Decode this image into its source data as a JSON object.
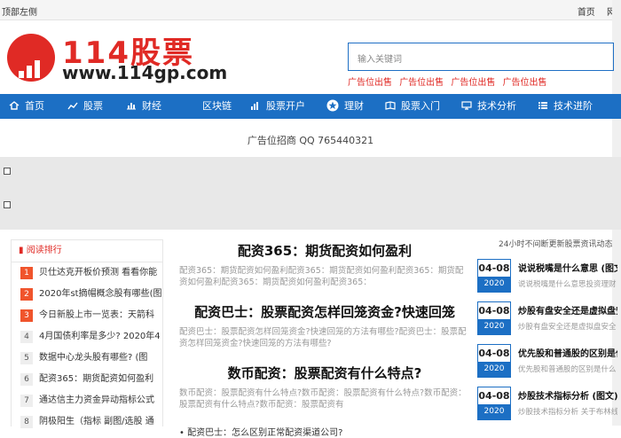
{
  "topbar": {
    "left_text": "顶部左侧",
    "links": [
      "首页",
      "网"
    ]
  },
  "logo": {
    "title": "114股票",
    "url": "www.114gp.com"
  },
  "search": {
    "placeholder": "输入关键词"
  },
  "header_ads": [
    "广告位出售",
    "广告位出售",
    "广告位出售",
    "广告位出售"
  ],
  "nav": [
    {
      "label": "首页",
      "icon": "home-icon"
    },
    {
      "label": "股票",
      "icon": "chart-line-icon"
    },
    {
      "label": "财经",
      "icon": "bar-chart-icon"
    },
    {
      "label": "区块链",
      "icon": "none"
    },
    {
      "label": "股票开户",
      "icon": "bar-chart-icon"
    },
    {
      "label": "理财",
      "icon": "star-icon"
    },
    {
      "label": "股票入门",
      "icon": "book-icon"
    },
    {
      "label": "技术分析",
      "icon": "monitor-icon"
    },
    {
      "label": "技术进阶",
      "icon": "list-icon"
    }
  ],
  "banner_ad": "广告位招商 QQ 765440321",
  "ranking": {
    "title": "阅读排行",
    "items": [
      {
        "num": "1",
        "text": "贝仕达克开板价预测 看看你能"
      },
      {
        "num": "2",
        "text": "2020年st摘帽概念股有哪些(图"
      },
      {
        "num": "3",
        "text": "今日新股上市一览表：天箭科"
      },
      {
        "num": "4",
        "text": "4月国债利率是多少? 2020年4"
      },
      {
        "num": "5",
        "text": "数据中心龙头股有哪些? (图"
      },
      {
        "num": "6",
        "text": "配资365：期货配资如何盈利"
      },
      {
        "num": "7",
        "text": "通达信主力资金异动指标公式"
      },
      {
        "num": "8",
        "text": "阴极阳生（指标 副图/选股 通"
      }
    ]
  },
  "articles": [
    {
      "title": "配资365：期货配资如何盈利",
      "summary": "配资365：期货配资如何盈利配资365：期货配资如何盈利配资365：期货配资如何盈利配资365：期货配资如何盈利配资365："
    },
    {
      "title": "配资巴士：股票配资怎样回笼资金?快速回笼",
      "summary": "配资巴士：股票配资怎样回笼资金?快速回笼的方法有哪些?配资巴士：股票配资怎样回笼资金?快速回笼的方法有哪些?"
    },
    {
      "title": "数币配资：股票配资有什么特点?",
      "summary": "数币配资：股票配资有什么特点?数币配资：股票配资有什么特点?数币配资：股票配资有什么特点?数币配资：股票配资有"
    }
  ],
  "bullet_link": "配资巴士：怎么区别正常配资渠道公司?",
  "news": {
    "header": "24小时不间断更新股票资讯动态",
    "items": [
      {
        "date": "04-08",
        "year": "2020",
        "title": "说说税嘴是什么意思 (图文",
        "sub": "说说税嘴是什么意思投资理财"
      },
      {
        "date": "04-08",
        "year": "2020",
        "title": "炒股有盘安全还是虚拟盘安",
        "sub": "炒股有盘安全还是虚拟盘安全"
      },
      {
        "date": "04-08",
        "year": "2020",
        "title": "优先股和普通股的区别是什",
        "sub": "优先股和普通股的区别是什么"
      },
      {
        "date": "04-08",
        "year": "2020",
        "title": "炒股技术指标分析 (图文)",
        "sub": "炒股技术指标分析 关于布林线"
      }
    ]
  },
  "colors": {
    "brand_red": "#e02a25",
    "nav_blue": "#1c6fc4"
  }
}
